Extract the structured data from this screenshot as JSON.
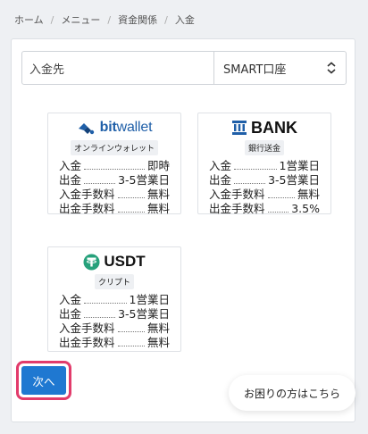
{
  "breadcrumb": [
    "ホーム",
    "メニュー",
    "資金関係",
    "入金"
  ],
  "selector": {
    "label": "入金先",
    "value": "SMART口座"
  },
  "cards": {
    "bitwallet": {
      "brand_prefix": "bit",
      "brand_suffix": "wallet",
      "tag": "オンラインウォレット",
      "rows": [
        {
          "k": "入金",
          "v": "即時"
        },
        {
          "k": "出金",
          "v": "3-5営業日"
        },
        {
          "k": "入金手数料",
          "v": "無料"
        },
        {
          "k": "出金手数料",
          "v": "無料"
        }
      ]
    },
    "bank": {
      "brand": "BANK",
      "tag": "銀行送金",
      "rows": [
        {
          "k": "入金",
          "v": "1営業日"
        },
        {
          "k": "出金",
          "v": "3-5営業日"
        },
        {
          "k": "入金手数料",
          "v": "無料"
        },
        {
          "k": "出金手数料",
          "v": "3.5%"
        }
      ]
    },
    "usdt": {
      "brand": "USDT",
      "tag": "クリプト",
      "rows": [
        {
          "k": "入金",
          "v": "1営業日"
        },
        {
          "k": "出金",
          "v": "3-5営業日"
        },
        {
          "k": "入金手数料",
          "v": "無料"
        },
        {
          "k": "出金手数料",
          "v": "無料"
        }
      ]
    }
  },
  "next_button": "次へ",
  "help_button": "お困りの方はこちら",
  "colors": {
    "accent": "#1f78d1",
    "highlight": "#e23b6b",
    "tether": "#26a17b",
    "bitwallet": "#1f5fa8"
  }
}
